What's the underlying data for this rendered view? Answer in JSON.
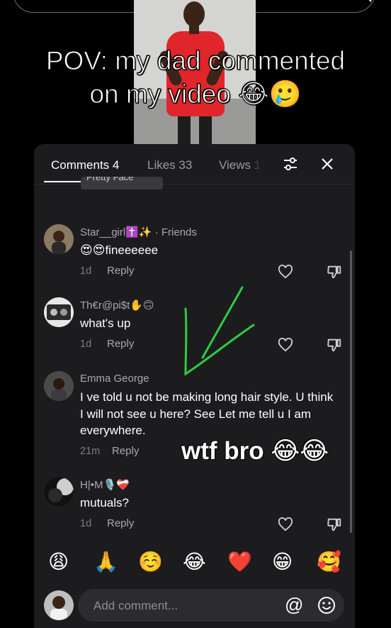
{
  "caption": {
    "line1": "POV: my dad commented",
    "line2": "on my video 😂🥲"
  },
  "tabs": {
    "comments": "Comments 4",
    "likes": "Likes 33",
    "views": "Views 1"
  },
  "clipped_chip": "Pretty Face",
  "comments": [
    {
      "username": "Star__girl✝️✨ · Friends",
      "text": "😍😍fineeeeee",
      "time": "1d",
      "reply": "Reply"
    },
    {
      "username": "Th€r@pi$t✋🙃",
      "text": "what's up",
      "time": "1d",
      "reply": "Reply"
    },
    {
      "username": "Emma George",
      "text": "I ve told u not be making long hair style. U think I will not see u here? See Let me tell u I am everywhere.",
      "time": "21m",
      "reply": "Reply"
    },
    {
      "username": "H|•M🎙️❤️‍🩹",
      "text": "mutuals?",
      "time": "1d",
      "reply": "Reply"
    }
  ],
  "emoji_bar": [
    "😩",
    "🙏",
    "☺️",
    "😂",
    "❤️",
    "😁",
    "🥰"
  ],
  "input": {
    "placeholder": "Add comment...",
    "mention_symbol": "@"
  },
  "overlay_text": "wtf bro 😂😂",
  "colors": {
    "panel_bg": "#1c1c1e",
    "annotation_green": "#2ecc40",
    "shirt_red": "#e0262b"
  }
}
